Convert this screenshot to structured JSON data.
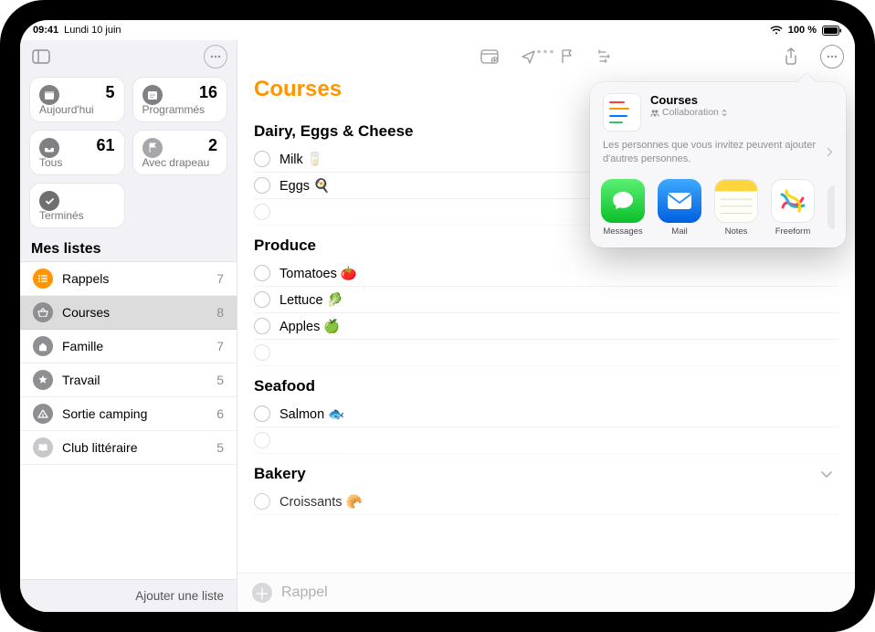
{
  "status": {
    "time": "09:41",
    "date": "Lundi 10 juin",
    "battery_text": "100 %"
  },
  "sidebar": {
    "smart": [
      {
        "label": "Aujourd'hui",
        "count": "5",
        "color": "#7f7f84"
      },
      {
        "label": "Programmés",
        "count": "16",
        "color": "#7f7f84"
      },
      {
        "label": "Tous",
        "count": "61",
        "color": "#7f7f84"
      },
      {
        "label": "Avec drapeau",
        "count": "2",
        "color": "#a7a7ab"
      },
      {
        "label": "Terminés",
        "count": "",
        "color": "#6f6f73"
      }
    ],
    "header": "Mes listes",
    "lists": [
      {
        "name": "Rappels",
        "count": "7",
        "color": "#ff9500",
        "selected": false
      },
      {
        "name": "Courses",
        "count": "8",
        "color": "#8e8e93",
        "selected": true
      },
      {
        "name": "Famille",
        "count": "7",
        "color": "#8e8e93",
        "selected": false
      },
      {
        "name": "Travail",
        "count": "5",
        "color": "#8e8e93",
        "selected": false
      },
      {
        "name": "Sortie camping",
        "count": "6",
        "color": "#8e8e93",
        "selected": false
      },
      {
        "name": "Club littéraire",
        "count": "5",
        "color": "#c7c7cc",
        "selected": false
      }
    ],
    "footer": "Ajouter une liste"
  },
  "main": {
    "title": "Courses",
    "footer_placeholder": "Rappel",
    "sections": [
      {
        "name": "Dairy, Eggs & Cheese",
        "items": [
          {
            "text": "Milk 🥛"
          },
          {
            "text": "Eggs 🍳"
          },
          {
            "text": "",
            "empty": true
          }
        ]
      },
      {
        "name": "Produce",
        "items": [
          {
            "text": "Tomatoes 🍅"
          },
          {
            "text": "Lettuce 🥬"
          },
          {
            "text": "Apples 🍏"
          },
          {
            "text": "",
            "empty": true
          }
        ]
      },
      {
        "name": "Seafood",
        "items": [
          {
            "text": "Salmon 🐟"
          },
          {
            "text": "",
            "empty": true
          }
        ]
      },
      {
        "name": "Bakery",
        "collapsible": true,
        "items": [
          {
            "text": "Croissants 🥐"
          }
        ]
      }
    ]
  },
  "share": {
    "title": "Courses",
    "subtitle": "Collaboration",
    "note": "Les personnes que vous invitez peuvent ajouter d'autres personnes.",
    "apps": [
      {
        "label": "Messages",
        "color": "#34c759",
        "glyph": "msg"
      },
      {
        "label": "Mail",
        "color": "#0a84ff",
        "glyph": "mail"
      },
      {
        "label": "Notes",
        "color": "#ffffff",
        "glyph": "notes"
      },
      {
        "label": "Freeform",
        "color": "#ffffff",
        "glyph": "freeform"
      }
    ]
  }
}
